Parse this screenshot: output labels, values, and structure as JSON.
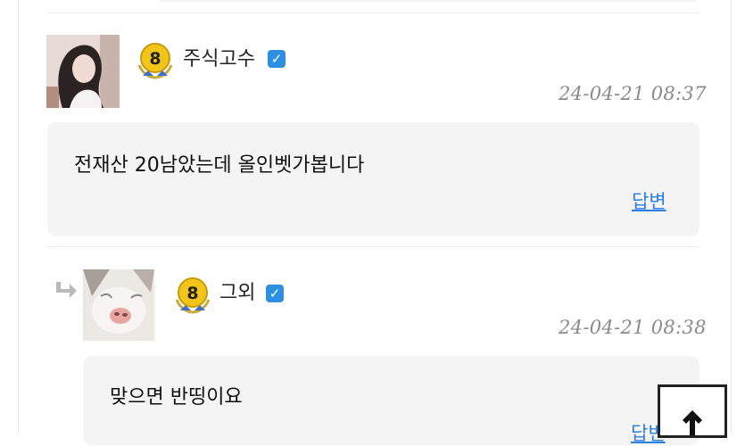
{
  "comments": [
    {
      "nickname": "주식고수",
      "level": "8",
      "timestamp": "24-04-21 08:37",
      "content": "전재산 20남았는데 올인벳가봅니다",
      "reply_label": "답변",
      "verified_mark": "✓"
    },
    {
      "nickname": "그외",
      "level": "8",
      "timestamp": "24-04-21 08:38",
      "content": "맞으면 반띵이요",
      "reply_label": "답변",
      "verified_mark": "✓"
    }
  ],
  "icons": {
    "reply_indicator": "reply-arrow-icon",
    "scroll_top": "arrow-up-icon",
    "badge": "level-medal-icon"
  },
  "colors": {
    "link": "#2b7de0",
    "verified": "#2d8fe0",
    "bubble_bg": "#f4f4f4",
    "timestamp": "#8a8a8a"
  }
}
